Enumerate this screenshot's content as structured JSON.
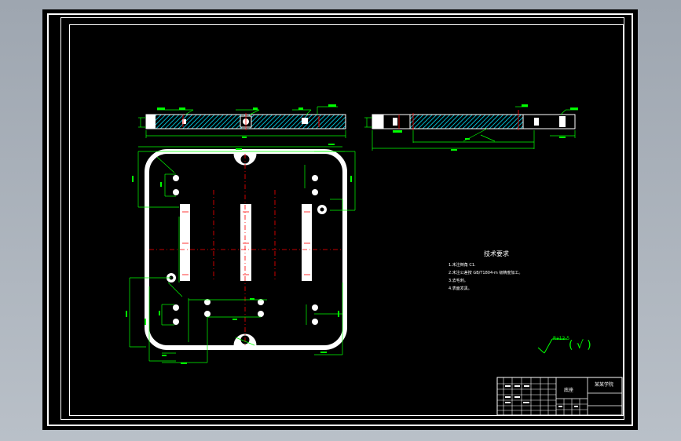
{
  "technical_requirements": {
    "title": "技术要求",
    "lines": [
      "1.未注倒角 C1.",
      "2.未注公差按 GB/T1804-m 级精度加工。",
      "3.去毛刺。",
      "4.表面发黑。"
    ]
  },
  "roughness": {
    "value": "Ra12.5",
    "bracket": "( √ )"
  },
  "title_block": {
    "part_name": "底座",
    "company": "某某学院"
  },
  "colors": {
    "background": "#000000",
    "outline": "#ffffff",
    "dimension": "#00ff00",
    "centerline": "#ff0000",
    "hatch": "#00e5ff"
  }
}
